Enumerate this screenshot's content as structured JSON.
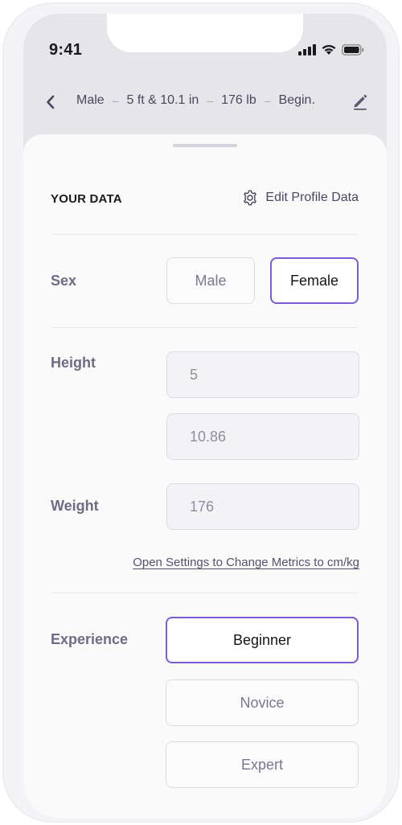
{
  "status": {
    "time": "9:41"
  },
  "summary": {
    "sex": "Male",
    "sep": "–",
    "height": "5 ft & 10.1 in",
    "weight": "176 lb",
    "experience": "Begin."
  },
  "section": {
    "title": "YOUR DATA",
    "edit_profile_label": "Edit Profile Data"
  },
  "sex": {
    "label": "Sex",
    "options": [
      "Male",
      "Female"
    ],
    "selected": "Female"
  },
  "height": {
    "label": "Height",
    "feet_value": "5",
    "feet_unit": "feet",
    "inch_value": "10.86",
    "inch_unit": "inch"
  },
  "weight": {
    "label": "Weight",
    "value": "176",
    "unit": "lbs"
  },
  "metrics_link": "Open Settings to Change Metrics to cm/kg",
  "experience": {
    "label": "Experience",
    "options": [
      "Beginner",
      "Novice",
      "Expert"
    ],
    "selected": "Beginner"
  },
  "colors": {
    "accent": "#7b5bd6",
    "label_text": "#6e6b86",
    "header_bg": "#e5e5ea"
  },
  "icons": {
    "back": "chevron-left-icon",
    "edit": "pencil-icon",
    "settings": "gear-icon",
    "signal": "signal-icon",
    "wifi": "wifi-icon",
    "battery": "battery-icon"
  }
}
